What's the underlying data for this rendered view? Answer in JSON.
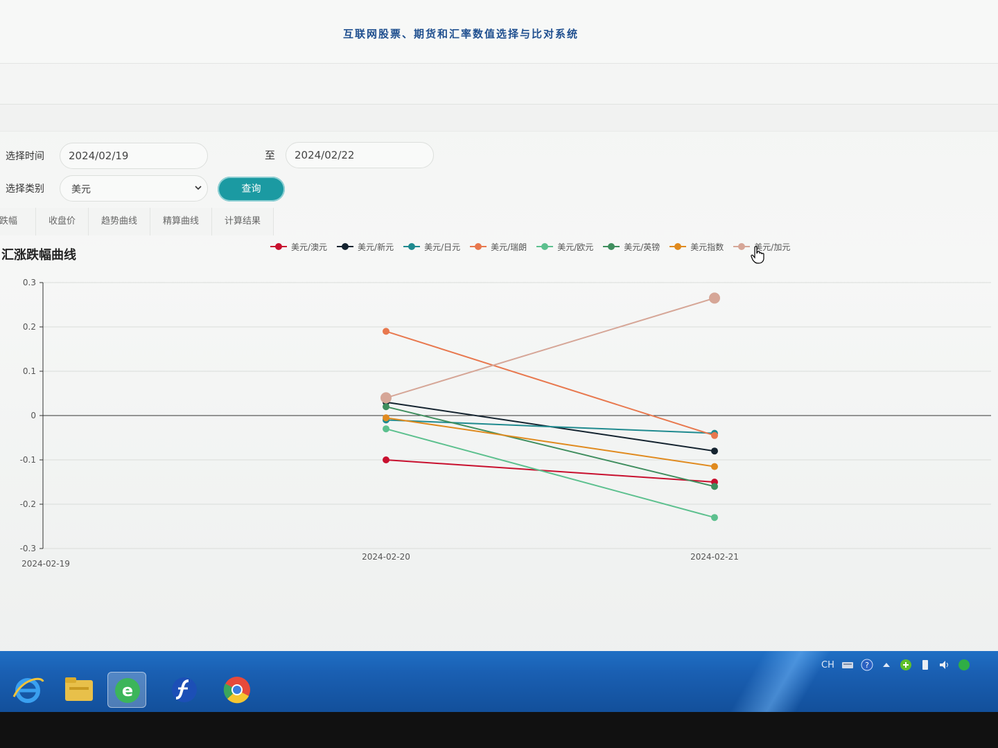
{
  "header": {
    "title": "互联网股票、期货和汇率数值选择与比对系统"
  },
  "form": {
    "time_label": "选择时间",
    "start_date": "2024/02/19",
    "to_label": "至",
    "end_date": "2024/02/22",
    "category_label": "选择类别",
    "category_value": "美元",
    "query_label": "查询"
  },
  "tabs": [
    "涨跌幅",
    "收盘价",
    "趋势曲线",
    "精算曲线",
    "计算结果"
  ],
  "taskbar": {
    "lang": "CH",
    "apps": [
      "ie-icon",
      "file-explorer-icon",
      "browser-e-icon",
      "flash-icon",
      "chrome-icon"
    ]
  },
  "chart_data": {
    "type": "line",
    "title": "汇涨跌幅曲线",
    "categories": [
      "2024-02-19",
      "2024-02-20",
      "2024-02-21"
    ],
    "ylim": [
      -0.3,
      0.3
    ],
    "yticks": [
      0.3,
      0.2,
      0.1,
      0,
      -0.1,
      -0.2,
      -0.3
    ],
    "legend_position": "top",
    "series": [
      {
        "name": "美元/澳元",
        "color": "#c8102e",
        "values": [
          null,
          -0.1,
          -0.15
        ]
      },
      {
        "name": "美元/新元",
        "color": "#14232f",
        "values": [
          null,
          0.03,
          -0.08
        ]
      },
      {
        "name": "美元/日元",
        "color": "#1f8a8f",
        "values": [
          null,
          -0.01,
          -0.04
        ]
      },
      {
        "name": "美元/瑞朗",
        "color": "#e8784e",
        "values": [
          null,
          0.19,
          -0.045
        ]
      },
      {
        "name": "美元/欧元",
        "color": "#5cc08e",
        "values": [
          null,
          -0.03,
          -0.23
        ]
      },
      {
        "name": "美元/英镑",
        "color": "#3f8e5e",
        "values": [
          null,
          0.02,
          -0.16
        ]
      },
      {
        "name": "美元指数",
        "color": "#e08a1e",
        "values": [
          null,
          -0.005,
          -0.115
        ]
      },
      {
        "name": "美元/加元",
        "color": "#d6a697",
        "values": [
          null,
          0.04,
          0.265
        ]
      }
    ]
  }
}
